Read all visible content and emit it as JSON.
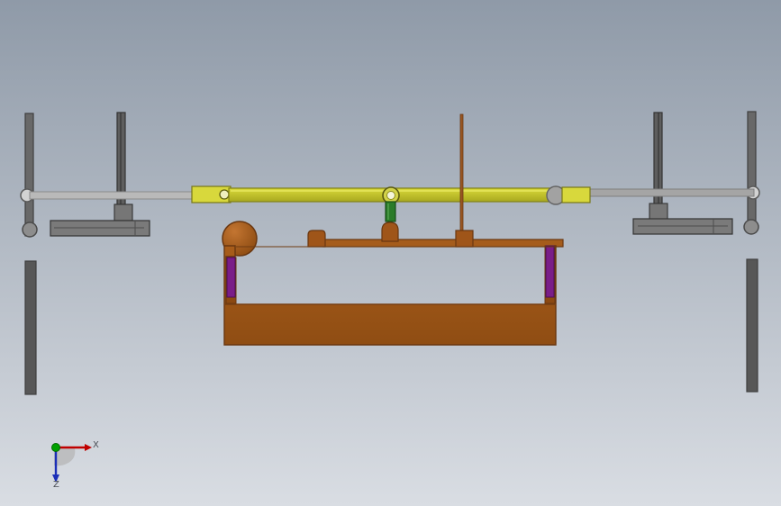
{
  "view": {
    "background_top": "#8f9aa8",
    "background_bottom": "#d9dde3"
  },
  "colors": {
    "frame_gray": "#696969",
    "frame_dark": "#404040",
    "rod_gray": "#a3a3a3",
    "arm_gray": "#8a8a8a",
    "yellow_rod": "#c9c92a",
    "yellow_dark": "#8f8f16",
    "copper": "#9c5518",
    "copper_dark": "#6f3a0b",
    "copper_light": "#b66a25",
    "purple": "#7a1a86",
    "green_link": "#1f7a1f",
    "axis_x": "#c00000",
    "axis_y": "#00a000",
    "axis_z": "#1b2fb8"
  },
  "axes": {
    "x_label": "X",
    "z_label": "Z"
  }
}
